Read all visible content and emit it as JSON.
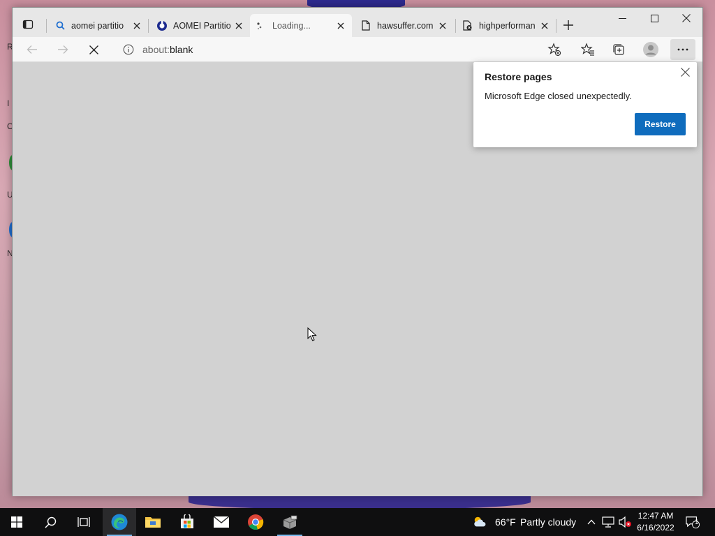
{
  "desktop": {
    "edge_letters": [
      "R",
      "I",
      "C",
      "U",
      "N"
    ]
  },
  "tabs": [
    {
      "label": "aomei partitio",
      "icon": "search-icon",
      "active": false
    },
    {
      "label": "AOMEI Partitio",
      "icon": "aomei-logo-icon",
      "active": false
    },
    {
      "label": "Loading...",
      "icon": "loading-spinner-icon",
      "active": true
    },
    {
      "label": "hawsuffer.com",
      "icon": "page-icon",
      "active": false
    },
    {
      "label": "highperforman",
      "icon": "page-error-icon",
      "active": false
    }
  ],
  "address_bar": {
    "url_dim": "about:",
    "url_main": "blank"
  },
  "popup": {
    "title": "Restore pages",
    "message": "Microsoft Edge closed unexpectedly.",
    "button_label": "Restore"
  },
  "taskbar": {
    "weather_temp": "66°F",
    "weather_text": "Partly cloudy",
    "time": "12:47 AM",
    "date": "6/16/2022",
    "notification_count": "1"
  },
  "colors": {
    "accent": "#0f6cbd",
    "taskbar": "#0f0f10"
  }
}
